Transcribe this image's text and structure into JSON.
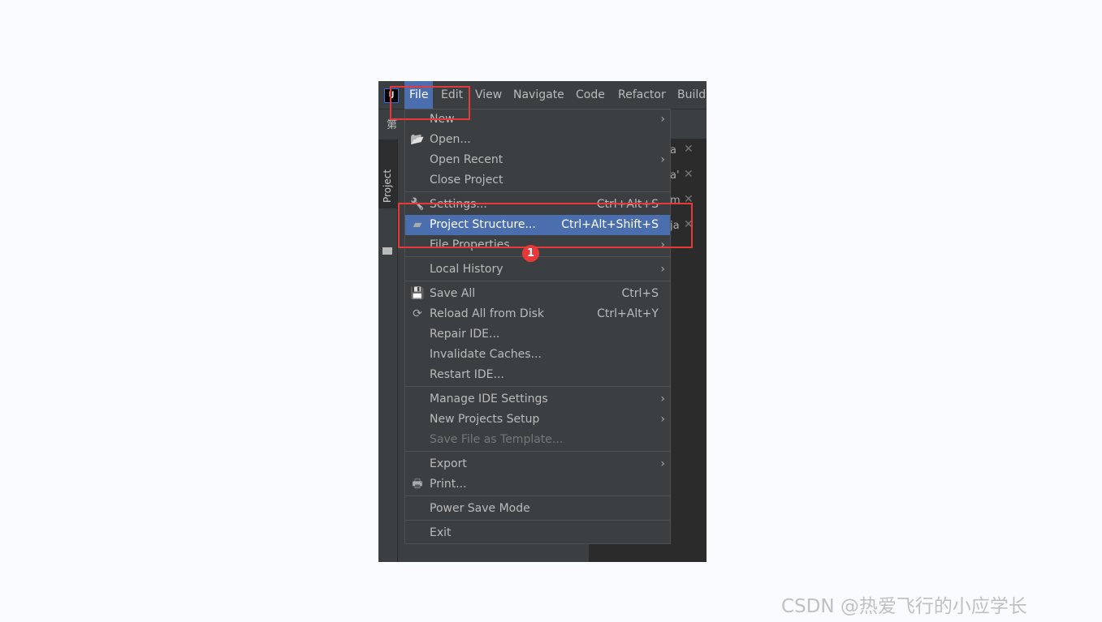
{
  "menubar": {
    "logo": "IJ",
    "items": [
      "File",
      "Edit",
      "View",
      "Navigate",
      "Code",
      "Refactor",
      "Build"
    ],
    "active": "File"
  },
  "toolbar": {
    "project_name_fragment": "第"
  },
  "sidebar": {
    "project_tab": "Project"
  },
  "editor_tabs": [
    "a",
    "a'",
    "m",
    "ja"
  ],
  "file_menu": [
    {
      "label": "New",
      "arrow": true
    },
    {
      "label": "Open...",
      "icon": "folder-open-icon"
    },
    {
      "label": "Open Recent",
      "arrow": true
    },
    {
      "label": "Close Project"
    },
    {
      "sep": true
    },
    {
      "label": "Settings...",
      "shortcut": "Ctrl+Alt+S",
      "icon": "wrench-icon"
    },
    {
      "label": "Project Structure...",
      "shortcut": "Ctrl+Alt+Shift+S",
      "icon": "project-structure-icon",
      "selected": true
    },
    {
      "label": "File Properties",
      "arrow": true
    },
    {
      "sep": true
    },
    {
      "label": "Local History",
      "arrow": true
    },
    {
      "sep": true
    },
    {
      "label": "Save All",
      "shortcut": "Ctrl+S",
      "icon": "save-icon"
    },
    {
      "label": "Reload All from Disk",
      "shortcut": "Ctrl+Alt+Y",
      "icon": "reload-icon"
    },
    {
      "label": "Repair IDE..."
    },
    {
      "label": "Invalidate Caches..."
    },
    {
      "label": "Restart IDE..."
    },
    {
      "sep": true
    },
    {
      "label": "Manage IDE Settings",
      "arrow": true
    },
    {
      "label": "New Projects Setup",
      "arrow": true
    },
    {
      "label": "Save File as Template...",
      "disabled": true
    },
    {
      "sep": true
    },
    {
      "label": "Export",
      "arrow": true
    },
    {
      "label": "Print...",
      "icon": "print-icon"
    },
    {
      "sep": true
    },
    {
      "label": "Power Save Mode"
    },
    {
      "sep": true
    },
    {
      "label": "Exit"
    }
  ],
  "annotation": {
    "step_badge": "1",
    "highlight_color": "#e8393a"
  },
  "watermark": "CSDN @热爱飞行的小应学长"
}
